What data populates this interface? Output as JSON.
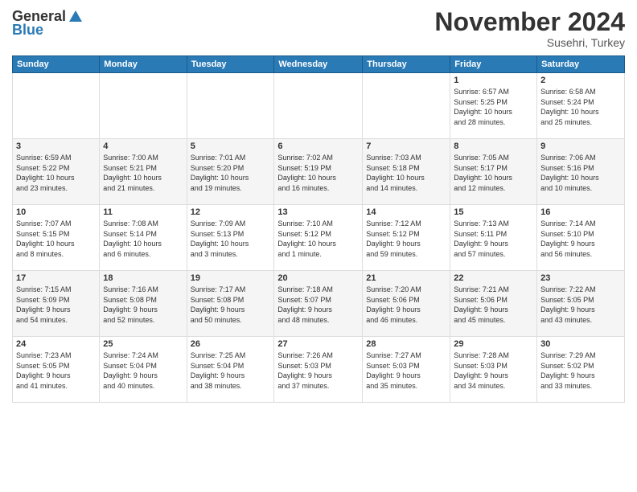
{
  "header": {
    "logo_general": "General",
    "logo_blue": "Blue",
    "month_title": "November 2024",
    "subtitle": "Susehri, Turkey"
  },
  "days_of_week": [
    "Sunday",
    "Monday",
    "Tuesday",
    "Wednesday",
    "Thursday",
    "Friday",
    "Saturday"
  ],
  "weeks": [
    {
      "days": [
        {
          "number": "",
          "info": ""
        },
        {
          "number": "",
          "info": ""
        },
        {
          "number": "",
          "info": ""
        },
        {
          "number": "",
          "info": ""
        },
        {
          "number": "",
          "info": ""
        },
        {
          "number": "1",
          "info": "Sunrise: 6:57 AM\nSunset: 5:25 PM\nDaylight: 10 hours\nand 28 minutes."
        },
        {
          "number": "2",
          "info": "Sunrise: 6:58 AM\nSunset: 5:24 PM\nDaylight: 10 hours\nand 25 minutes."
        }
      ]
    },
    {
      "days": [
        {
          "number": "3",
          "info": "Sunrise: 6:59 AM\nSunset: 5:22 PM\nDaylight: 10 hours\nand 23 minutes."
        },
        {
          "number": "4",
          "info": "Sunrise: 7:00 AM\nSunset: 5:21 PM\nDaylight: 10 hours\nand 21 minutes."
        },
        {
          "number": "5",
          "info": "Sunrise: 7:01 AM\nSunset: 5:20 PM\nDaylight: 10 hours\nand 19 minutes."
        },
        {
          "number": "6",
          "info": "Sunrise: 7:02 AM\nSunset: 5:19 PM\nDaylight: 10 hours\nand 16 minutes."
        },
        {
          "number": "7",
          "info": "Sunrise: 7:03 AM\nSunset: 5:18 PM\nDaylight: 10 hours\nand 14 minutes."
        },
        {
          "number": "8",
          "info": "Sunrise: 7:05 AM\nSunset: 5:17 PM\nDaylight: 10 hours\nand 12 minutes."
        },
        {
          "number": "9",
          "info": "Sunrise: 7:06 AM\nSunset: 5:16 PM\nDaylight: 10 hours\nand 10 minutes."
        }
      ]
    },
    {
      "days": [
        {
          "number": "10",
          "info": "Sunrise: 7:07 AM\nSunset: 5:15 PM\nDaylight: 10 hours\nand 8 minutes."
        },
        {
          "number": "11",
          "info": "Sunrise: 7:08 AM\nSunset: 5:14 PM\nDaylight: 10 hours\nand 6 minutes."
        },
        {
          "number": "12",
          "info": "Sunrise: 7:09 AM\nSunset: 5:13 PM\nDaylight: 10 hours\nand 3 minutes."
        },
        {
          "number": "13",
          "info": "Sunrise: 7:10 AM\nSunset: 5:12 PM\nDaylight: 10 hours\nand 1 minute."
        },
        {
          "number": "14",
          "info": "Sunrise: 7:12 AM\nSunset: 5:12 PM\nDaylight: 9 hours\nand 59 minutes."
        },
        {
          "number": "15",
          "info": "Sunrise: 7:13 AM\nSunset: 5:11 PM\nDaylight: 9 hours\nand 57 minutes."
        },
        {
          "number": "16",
          "info": "Sunrise: 7:14 AM\nSunset: 5:10 PM\nDaylight: 9 hours\nand 56 minutes."
        }
      ]
    },
    {
      "days": [
        {
          "number": "17",
          "info": "Sunrise: 7:15 AM\nSunset: 5:09 PM\nDaylight: 9 hours\nand 54 minutes."
        },
        {
          "number": "18",
          "info": "Sunrise: 7:16 AM\nSunset: 5:08 PM\nDaylight: 9 hours\nand 52 minutes."
        },
        {
          "number": "19",
          "info": "Sunrise: 7:17 AM\nSunset: 5:08 PM\nDaylight: 9 hours\nand 50 minutes."
        },
        {
          "number": "20",
          "info": "Sunrise: 7:18 AM\nSunset: 5:07 PM\nDaylight: 9 hours\nand 48 minutes."
        },
        {
          "number": "21",
          "info": "Sunrise: 7:20 AM\nSunset: 5:06 PM\nDaylight: 9 hours\nand 46 minutes."
        },
        {
          "number": "22",
          "info": "Sunrise: 7:21 AM\nSunset: 5:06 PM\nDaylight: 9 hours\nand 45 minutes."
        },
        {
          "number": "23",
          "info": "Sunrise: 7:22 AM\nSunset: 5:05 PM\nDaylight: 9 hours\nand 43 minutes."
        }
      ]
    },
    {
      "days": [
        {
          "number": "24",
          "info": "Sunrise: 7:23 AM\nSunset: 5:05 PM\nDaylight: 9 hours\nand 41 minutes."
        },
        {
          "number": "25",
          "info": "Sunrise: 7:24 AM\nSunset: 5:04 PM\nDaylight: 9 hours\nand 40 minutes."
        },
        {
          "number": "26",
          "info": "Sunrise: 7:25 AM\nSunset: 5:04 PM\nDaylight: 9 hours\nand 38 minutes."
        },
        {
          "number": "27",
          "info": "Sunrise: 7:26 AM\nSunset: 5:03 PM\nDaylight: 9 hours\nand 37 minutes."
        },
        {
          "number": "28",
          "info": "Sunrise: 7:27 AM\nSunset: 5:03 PM\nDaylight: 9 hours\nand 35 minutes."
        },
        {
          "number": "29",
          "info": "Sunrise: 7:28 AM\nSunset: 5:03 PM\nDaylight: 9 hours\nand 34 minutes."
        },
        {
          "number": "30",
          "info": "Sunrise: 7:29 AM\nSunset: 5:02 PM\nDaylight: 9 hours\nand 33 minutes."
        }
      ]
    }
  ]
}
